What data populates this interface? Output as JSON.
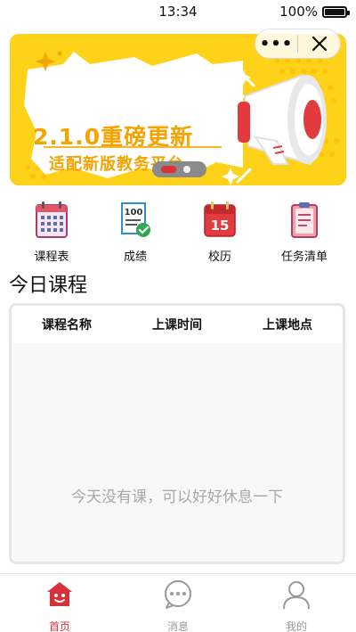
{
  "status_bar": {
    "time": "13:34",
    "battery": "100%",
    "battery_level": 1.0
  },
  "banner": {
    "title": "2.1.0重磅更新",
    "subtitle": "适配新版教务平台",
    "slide_index": 1,
    "slide_count": 2,
    "colors": {
      "background": "#ffd21a",
      "text": "#f5a300",
      "accent": "#d9313a"
    }
  },
  "capsule": {
    "more_label": "•••",
    "close_icon": "close-icon"
  },
  "quick_nav": [
    {
      "label": "课程表",
      "icon": "calendar-icon"
    },
    {
      "label": "成绩",
      "icon": "grade-report-icon"
    },
    {
      "label": "校历",
      "icon": "school-calendar-icon"
    },
    {
      "label": "任务清单",
      "icon": "clipboard-icon"
    }
  ],
  "today": {
    "title": "今日课程",
    "columns": [
      "课程名称",
      "上课时间",
      "上课地点"
    ],
    "rows": [],
    "empty_text": "今天没有课，可以好好休息一下"
  },
  "tab_bar": {
    "active_color": "#d9313a",
    "inactive_color": "#999999",
    "items": [
      {
        "label": "首页",
        "icon": "home-icon",
        "active": true
      },
      {
        "label": "消息",
        "icon": "message-icon",
        "active": false
      },
      {
        "label": "我的",
        "icon": "profile-icon",
        "active": false
      }
    ]
  }
}
